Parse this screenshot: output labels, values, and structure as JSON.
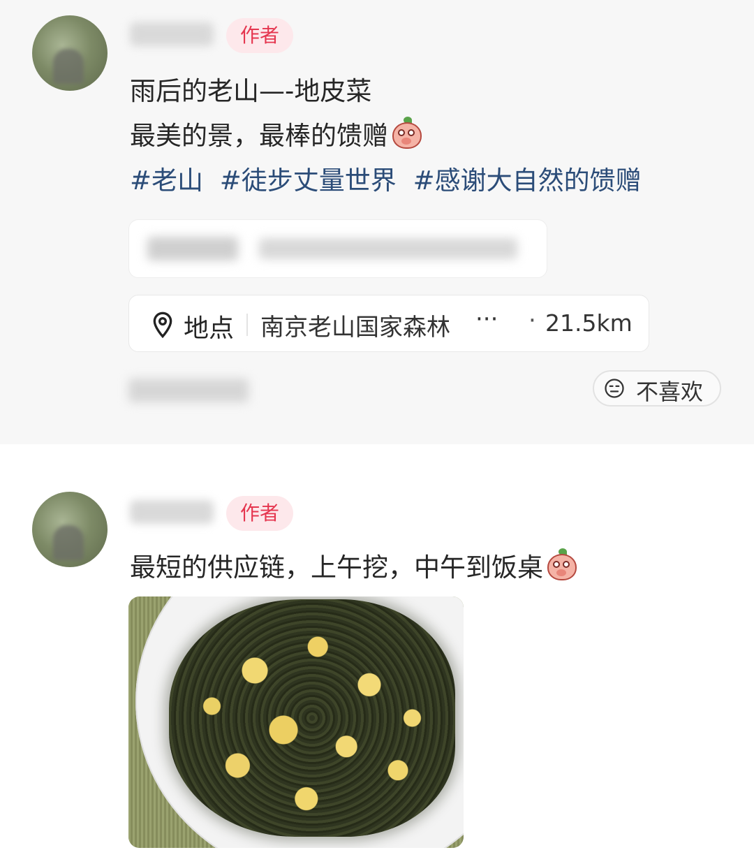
{
  "post1": {
    "author_badge": "作者",
    "line1": "雨后的老山—-地皮菜",
    "line2": "最美的景，最棒的馈赠",
    "hashtags": [
      "#老山",
      "#徒步丈量世界",
      "#感谢大自然的馈赠"
    ],
    "location": {
      "label": "地点",
      "place": "南京老山国家森林",
      "ellipsis": "···",
      "dot": "·",
      "distance": "21.5km"
    },
    "dislike_label": "不喜欢"
  },
  "post2": {
    "author_badge": "作者",
    "line1": "最短的供应链，上午挖，中午到饭桌"
  },
  "colors": {
    "badge_bg": "#fde8eb",
    "badge_text": "#e5364f",
    "hashtag": "#2b4c78",
    "section1_bg": "#f7f7f7"
  },
  "icons": {
    "location": "map-pin-icon",
    "dislike": "neutral-face-icon",
    "emoji": "peach-emoji-icon"
  }
}
